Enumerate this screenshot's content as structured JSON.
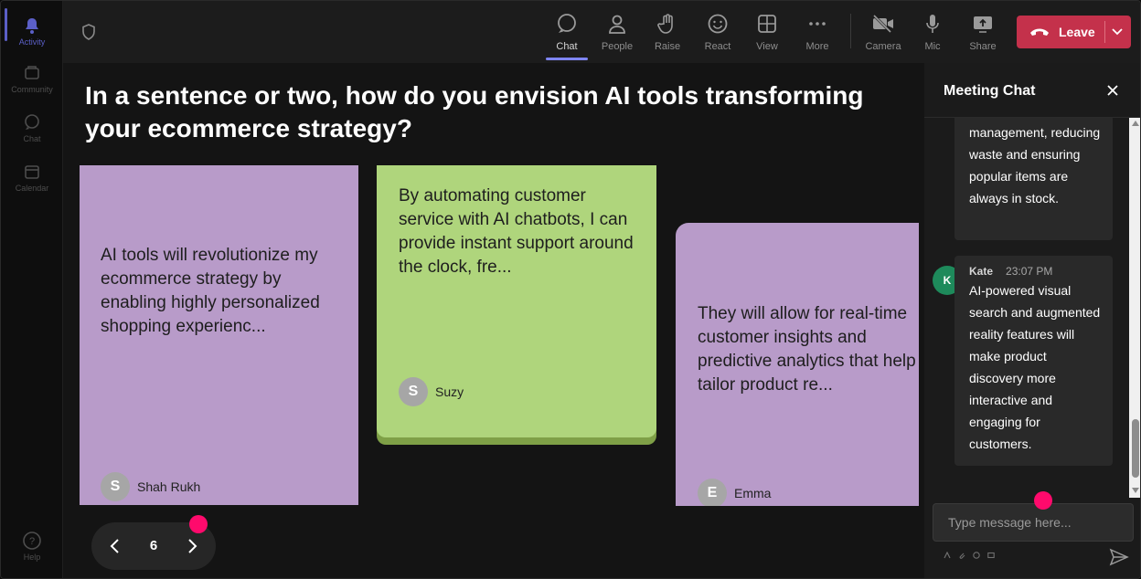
{
  "rail": {
    "items": [
      {
        "label": "Activity",
        "icon": "bell-icon"
      },
      {
        "label": "Community",
        "icon": "community-icon"
      },
      {
        "label": "Chat",
        "icon": "chat-icon"
      },
      {
        "label": "Calendar",
        "icon": "calendar-icon"
      }
    ],
    "help_label": "Help"
  },
  "toolbar": {
    "chat": "Chat",
    "people": "People",
    "raise": "Raise",
    "react": "React",
    "view": "View",
    "more": "More",
    "camera": "Camera",
    "mic": "Mic",
    "share": "Share",
    "leave": "Leave"
  },
  "stage": {
    "question": "In a sentence or two, how do you envision AI tools transforming your ecommerce strategy?",
    "cards": [
      {
        "text": "AI tools will revolutionize my ecommerce strategy by enabling highly personalized shopping experienc...",
        "author": "Shah Rukh",
        "initial": "S",
        "color": "#b89bc9"
      },
      {
        "text": "By automating customer service with AI chatbots, I can provide instant support around the clock, fre...",
        "author": "Suzy",
        "initial": "S",
        "color": "#afd57c"
      },
      {
        "text": "They will allow for real-time customer insights and predictive analytics that help tailor product re...",
        "author": "Emma",
        "initial": "E",
        "color": "#b89bc9"
      }
    ],
    "page_number": "6"
  },
  "chat": {
    "title": "Meeting Chat",
    "messages": [
      {
        "text": "management, reducing waste and ensuring popular items are always in stock."
      },
      {
        "author": "Kate",
        "initial": "K",
        "time": "23:07 PM",
        "text": "AI-powered visual search and augmented reality features will make product discovery more interactive and engaging for customers."
      }
    ],
    "input_placeholder": "Type message here..."
  },
  "colors": {
    "accent": "#5b5fc7",
    "leave": "#c4314b",
    "marker": "#ff0a6c"
  }
}
